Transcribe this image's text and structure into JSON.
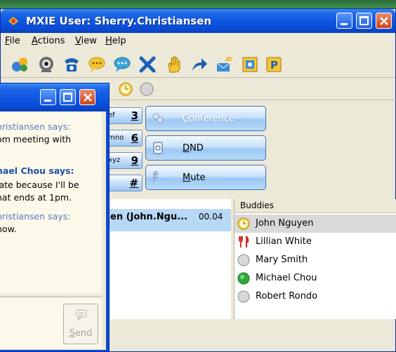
{
  "main_window": {
    "title": "MXIE User: Sherry.Christiansen",
    "menu": [
      "File",
      "Actions",
      "View",
      "Help"
    ],
    "toolbar_icons": [
      "presence-icon",
      "camera-icon",
      "phone-icon",
      "chat-icon",
      "group-chat-icon",
      "hangup-icon",
      "hold-hand-icon",
      "transfer-icon",
      "voicemail-icon",
      "notes-icon",
      "p-icon"
    ],
    "status_icons": [
      "clock-status-icon",
      "offline-status-icon"
    ],
    "dialpad": [
      {
        "letters": "ef",
        "digit": "3"
      },
      {
        "letters": "mno",
        "digit": "6"
      },
      {
        "letters": "xyz",
        "digit": "9"
      },
      {
        "letters": "",
        "digit": "#"
      }
    ],
    "call_buttons": [
      {
        "label": "Conference",
        "enabled": false,
        "icon": "conference-icon"
      },
      {
        "label": "DND",
        "enabled": true,
        "icon": "dnd-icon"
      },
      {
        "label": "Mute",
        "enabled": true,
        "icon": "mute-icon"
      }
    ],
    "active_call": {
      "name": "en (John.Ngu...",
      "duration": "00.04"
    },
    "buddies": {
      "header": "Buddies",
      "items": [
        {
          "name": "John Nguyen",
          "status": "away",
          "selected": true
        },
        {
          "name": "Lillian White",
          "status": "dining",
          "selected": false
        },
        {
          "name": "Mary Smith",
          "status": "offline",
          "selected": false
        },
        {
          "name": "Michael Chou",
          "status": "online",
          "selected": false
        },
        {
          "name": "Robert Rondo",
          "status": "offline",
          "selected": false
        }
      ]
    }
  },
  "chat_window": {
    "lines": [
      {
        "kind": "hdr",
        "text": "hristiansen says:"
      },
      {
        "kind": "msg",
        "text": "om meeting with"
      },
      {
        "kind": "hdr-bold",
        "text": "hael Chou says:"
      },
      {
        "kind": "msg",
        "text": "late because I'll be"
      },
      {
        "kind": "msg",
        "text": "hat ends at 1pm."
      },
      {
        "kind": "hdr",
        "text": "hristiansen says:"
      },
      {
        "kind": "msg",
        "text": "now."
      }
    ],
    "send_label": "Send"
  },
  "colors": {
    "titlebar": "#0c55e0",
    "window_bg": "#ece9d8",
    "call_row_bg": "#b7d9f5",
    "close_btn": "#d1431a"
  }
}
